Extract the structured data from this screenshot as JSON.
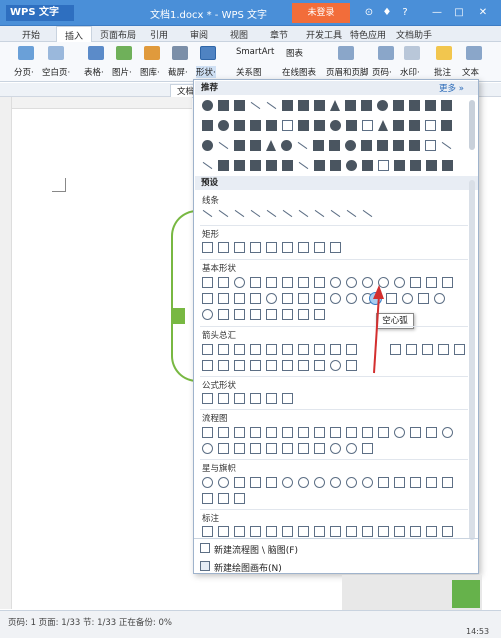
{
  "titlebar": {
    "app_name": "WPS 文字",
    "doc_title": "文档1.docx * - WPS 文字",
    "login_label": "未登录",
    "buttons": [
      "⊙",
      "♦",
      "?",
      "—",
      "□",
      "✕"
    ]
  },
  "menubar": {
    "items": [
      "开始",
      "插入",
      "页面布局",
      "引用",
      "审阅",
      "视图",
      "章节",
      "开发工具",
      "特色应用",
      "文档助手"
    ],
    "active": "插入"
  },
  "ribbon": {
    "buttons": [
      "分页·",
      "空白页·",
      "表格·",
      "图片·",
      "图库·",
      "截屏·",
      "形状·"
    ],
    "smartart_label": "SmartArt",
    "chart_label": "图表",
    "relation_label": "关系图",
    "online_chart_label": "在线图表",
    "header_footer_label": "页眉和页脚",
    "page_number_label": "页码·",
    "watermark_label": "水印·",
    "comment_label": "批注",
    "textbox_label": "文本"
  },
  "qat": {
    "doc_tab_label": "文档1"
  },
  "panel": {
    "recommend_label": "推荐",
    "more_label": "更多 »",
    "preset_label": "预设",
    "categories": [
      "线条",
      "矩形",
      "基本形状",
      "箭头总汇",
      "公式形状",
      "流程图",
      "星与旗帜",
      "标注"
    ],
    "tooltip": "空心弧",
    "new_flowchart_label": "新建流程图 \\ 脑图(F)",
    "new_canvas_label": "新建绘图画布(N)"
  },
  "statusbar": {
    "text": "页码: 1  页面: 1/33  节: 1/33     正在备份:  0%",
    "time": "14:53"
  },
  "colors": {
    "title_blue": "#4a8fd8",
    "login_orange": "#f26d3a",
    "bracket_green": "#78b842",
    "arrow_red": "#d32f2f"
  }
}
